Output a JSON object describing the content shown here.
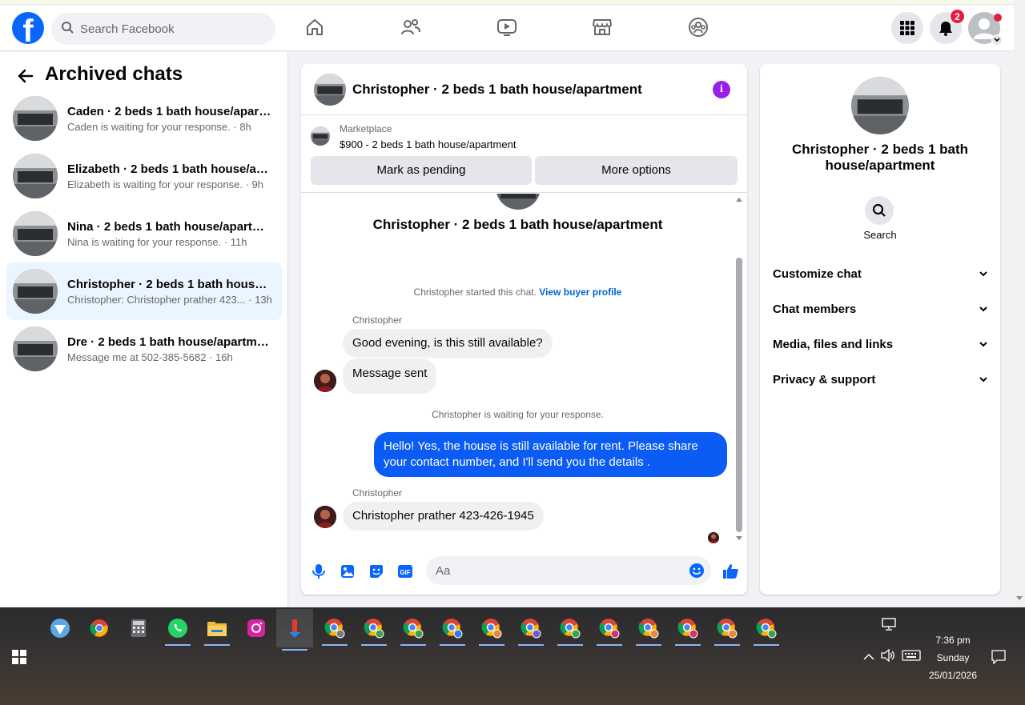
{
  "topbar": {
    "logo": "f",
    "search_placeholder": "Search Facebook",
    "nav_icons": [
      "home-icon",
      "friends-icon",
      "watch-icon",
      "marketplace-icon",
      "groups-icon"
    ],
    "notifications_count": "2"
  },
  "left": {
    "title": "Archived chats",
    "chats": [
      {
        "name": "Caden · 2 beds 1 bath house/apart...",
        "sub": "Caden is waiting for your response. · 8h"
      },
      {
        "name": "Elizabeth · 2 beds 1 bath house/ap...",
        "sub": "Elizabeth is waiting for your response. · 9h"
      },
      {
        "name": "Nina · 2 beds 1 bath house/apartm...",
        "sub": "Nina is waiting for your response. · 11h"
      },
      {
        "name": "Christopher · 2 beds 1 bath house/...",
        "sub": "Christopher: Christopher prather 423... · 13h"
      },
      {
        "name": "Dre · 2 beds 1 bath house/apartme...",
        "sub": "Message me at 502-385-5682 · 16h"
      }
    ]
  },
  "conversation": {
    "title": "Christopher · 2 beds 1 bath house/apartment",
    "marketplace_label": "Marketplace",
    "marketplace_item": "$900 - 2 beds 1 bath house/apartment",
    "mark_pending": "Mark as pending",
    "more_options": "More options",
    "intro_name": "Christopher · 2 beds 1 bath house/apartment",
    "started_text": "Christopher started this chat.",
    "view_profile": "View buyer profile",
    "sender1": "Christopher",
    "msg1": "Good evening, is this still available?",
    "msg2": "Message sent",
    "waiting": "Christopher is waiting for your response.",
    "my_msg": "Hello! Yes, the house is still available for rent. Please share your contact number, and I'll send you the details .",
    "sender2": "Christopher",
    "msg3": "Christopher prather 423-426-1945",
    "input_placeholder": "Aa"
  },
  "right": {
    "name": "Christopher · 2 beds 1 bath house/apartment",
    "search_label": "Search",
    "sections": [
      "Customize chat",
      "Chat members",
      "Media, files and links",
      "Privacy & support"
    ]
  },
  "taskbar": {
    "time": "7:36 pm",
    "day": "Sunday",
    "date": "25/01/2026"
  },
  "colors": {
    "brand": "#0866ff",
    "my_bubble": "#0a5cf5",
    "active_row": "#ebf5ff",
    "info": "#9b1fe8"
  }
}
